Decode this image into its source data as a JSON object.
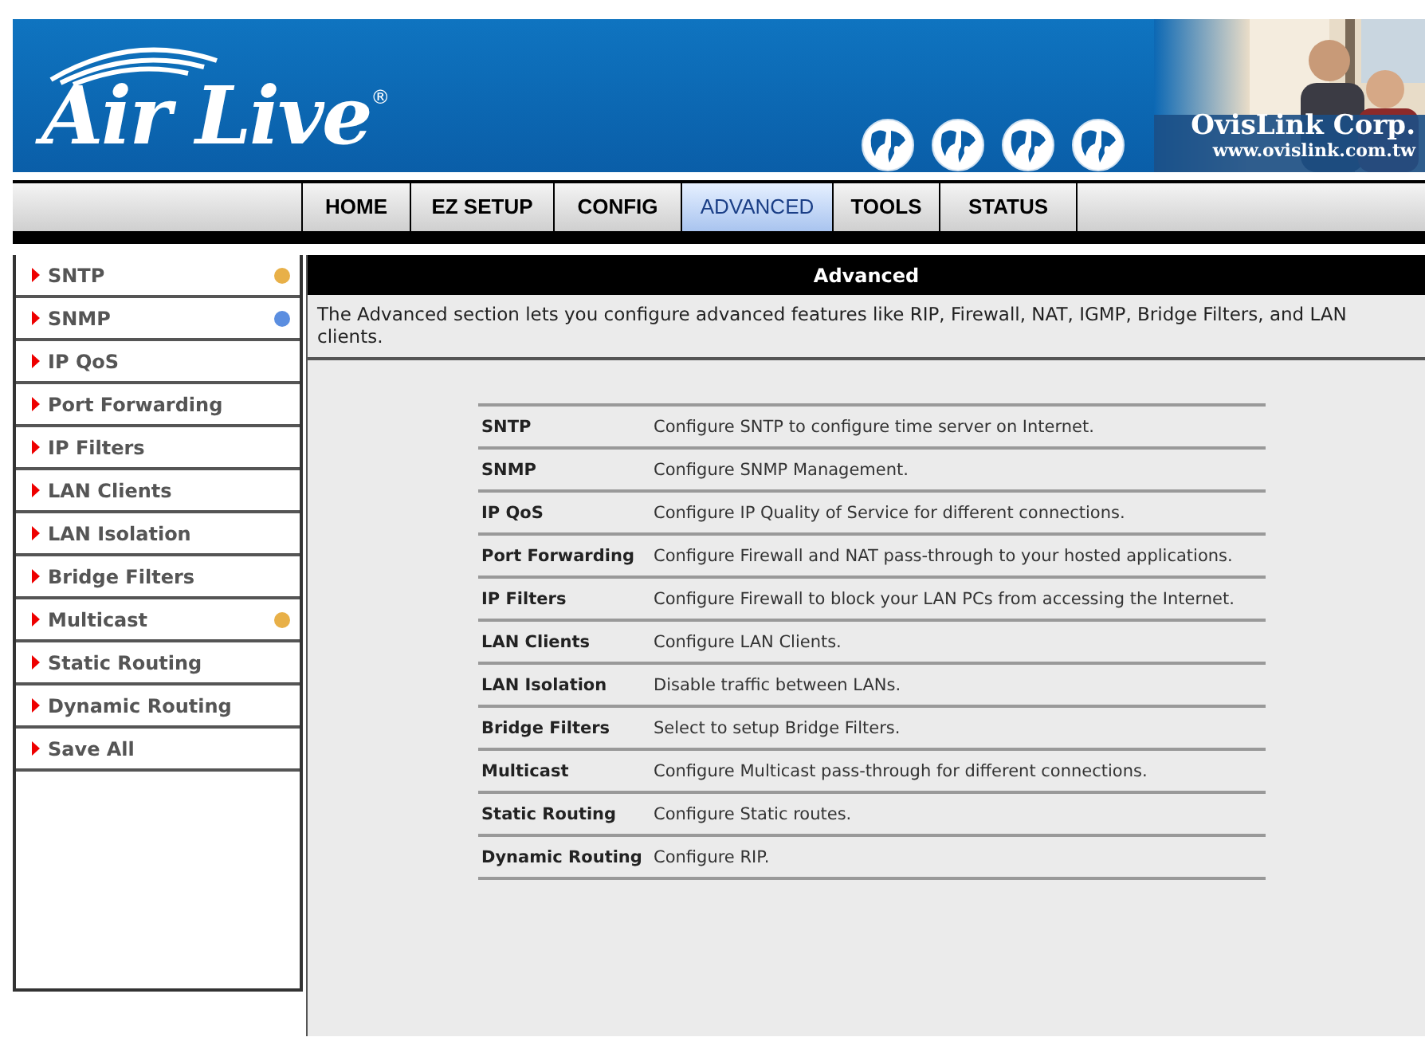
{
  "logo": {
    "text": "Air Live",
    "mark": "®"
  },
  "company": {
    "name": "OvisLink Corp.",
    "url": "www.ovislink.com.tw"
  },
  "nav": [
    {
      "label": "HOME",
      "selected": false
    },
    {
      "label": "EZ SETUP",
      "selected": false
    },
    {
      "label": "CONFIG",
      "selected": false
    },
    {
      "label": "ADVANCED",
      "selected": true
    },
    {
      "label": "TOOLS",
      "selected": false
    },
    {
      "label": "STATUS",
      "selected": false
    }
  ],
  "sidebar": {
    "items": [
      {
        "label": "SNTP",
        "color": "#e8b048"
      },
      {
        "label": "SNMP",
        "color": "#5b8ee0"
      },
      {
        "label": "IP QoS"
      },
      {
        "label": "Port Forwarding"
      },
      {
        "label": "IP Filters"
      },
      {
        "label": "LAN Clients"
      },
      {
        "label": "LAN Isolation"
      },
      {
        "label": "Bridge Filters"
      },
      {
        "label": "Multicast",
        "color": "#e8b048"
      },
      {
        "label": "Static Routing"
      },
      {
        "label": "Dynamic Routing"
      },
      {
        "label": "Save All"
      }
    ]
  },
  "section": {
    "title": "Advanced",
    "description": "The Advanced section lets you configure advanced features like RIP, Firewall, NAT, IGMP, Bridge Filters, and LAN clients."
  },
  "table": {
    "rows": [
      {
        "name": "SNTP",
        "description": "Configure SNTP to configure time server on Internet."
      },
      {
        "name": "SNMP",
        "description": "Configure SNMP Management."
      },
      {
        "name": "IP QoS",
        "description": "Configure IP Quality of Service for different connections."
      },
      {
        "name": "Port Forwarding",
        "description": "Configure Firewall and NAT pass-through to your hosted applications."
      },
      {
        "name": "IP Filters",
        "description": "Configure Firewall to block your LAN PCs from accessing the Internet."
      },
      {
        "name": "LAN Clients",
        "description": "Configure LAN Clients."
      },
      {
        "name": "LAN Isolation",
        "description": "Disable traffic between LANs."
      },
      {
        "name": "Bridge Filters",
        "description": "Select to setup Bridge Filters."
      },
      {
        "name": "Multicast",
        "description": "Configure Multicast pass-through for different connections."
      },
      {
        "name": "Static Routing",
        "description": "Configure Static routes."
      },
      {
        "name": "Dynamic Routing",
        "description": "Configure RIP."
      }
    ]
  }
}
